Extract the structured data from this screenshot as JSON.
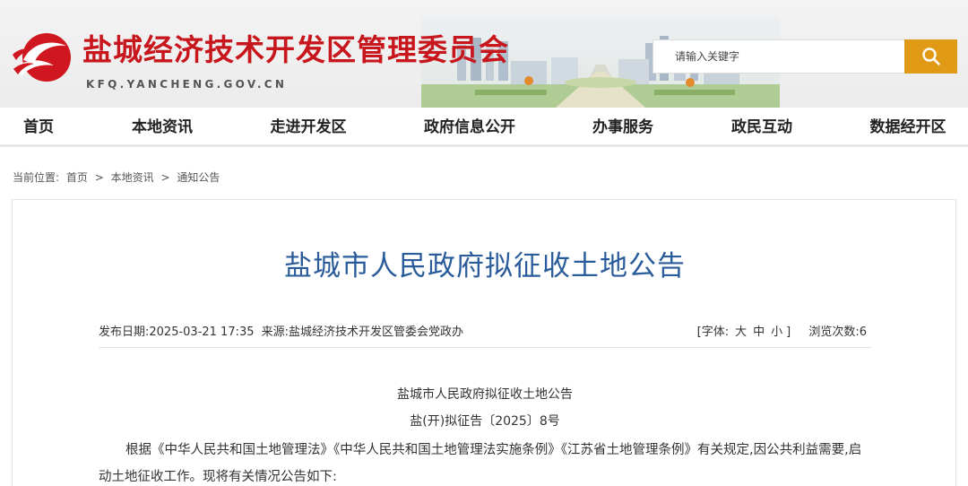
{
  "header": {
    "site_title": "盐城经济技术开发区管理委员会",
    "site_domain": "KFQ.YANCHENG.GOV.CN",
    "search_placeholder": "请输入关键字",
    "brand_color": "#c8161d",
    "search_button_color": "#e19a16"
  },
  "nav": {
    "items": [
      "首页",
      "本地资讯",
      "走进开发区",
      "政府信息公开",
      "办事服务",
      "政民互动",
      "数据经开区"
    ]
  },
  "breadcrumb": {
    "label": "当前位置:",
    "items": [
      "首页",
      "本地资讯",
      "通知公告"
    ],
    "separator": ">"
  },
  "article": {
    "title": "盐城市人民政府拟征收土地公告",
    "publish_date": "发布日期:2025-03-21 17:35",
    "source": "来源:盐城经济技术开发区管委会党政办",
    "font_label": "[字体:",
    "font_large": "大",
    "font_medium": "中",
    "font_small": "小",
    "font_close": "]",
    "views": "浏览次数:6",
    "heading": "盐城市人民政府拟征收土地公告",
    "doc_number": "盐(开)拟征告〔2025〕8号",
    "paragraph": "根据《中华人民共和国土地管理法》《中华人民共和国土地管理法实施条例》《江苏省土地管理条例》有关规定,因公共利益需要,启动土地征收工作。现将有关情况公告如下:",
    "title_color": "#2a5c9c"
  }
}
